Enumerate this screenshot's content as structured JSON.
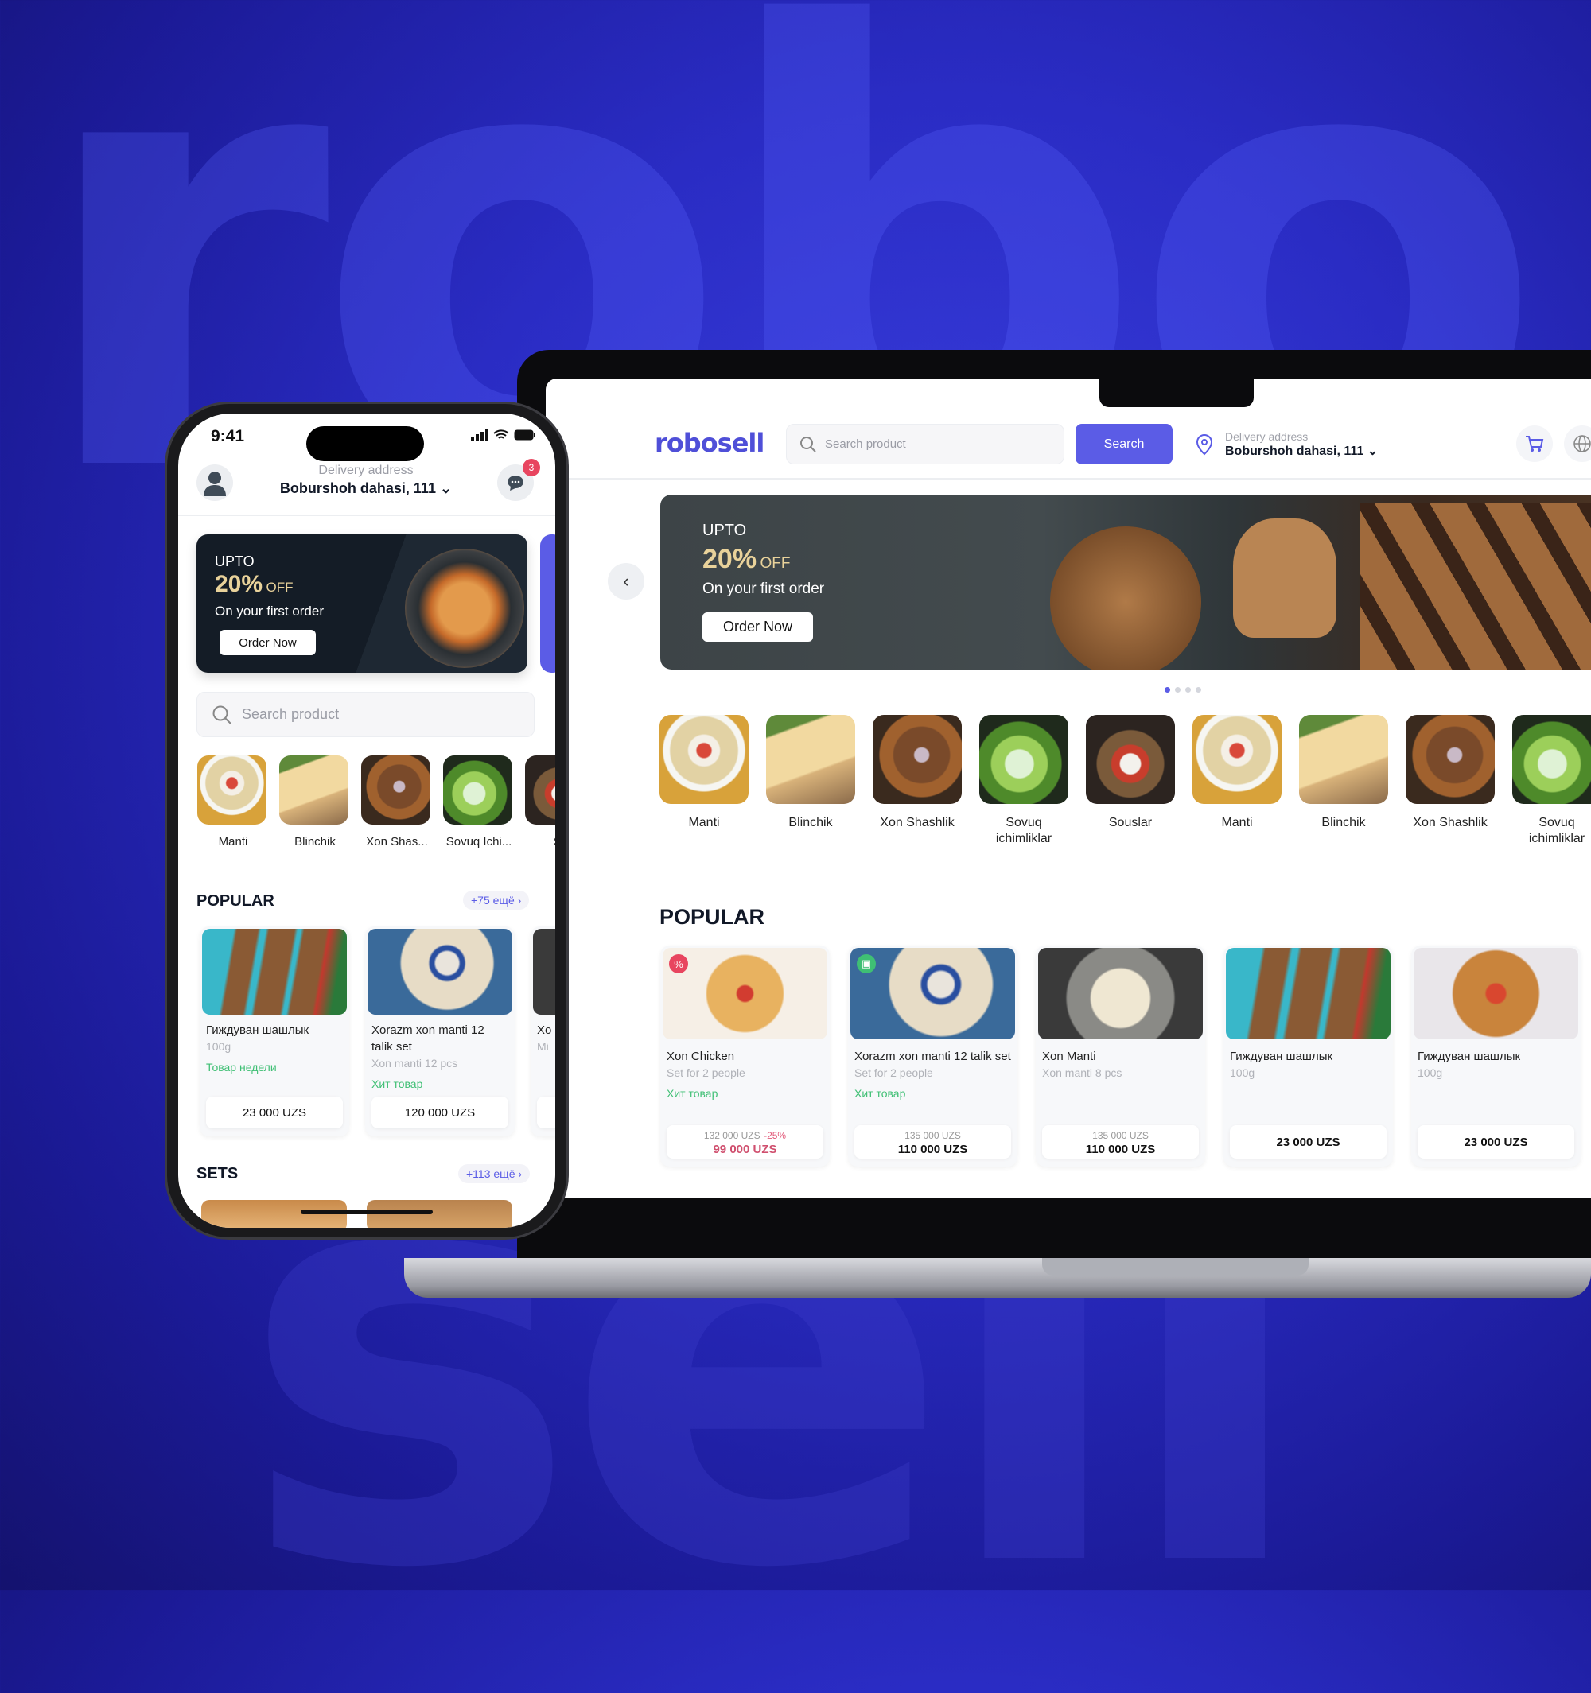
{
  "background": {
    "watermark_top": "robo",
    "watermark_bottom": "sell"
  },
  "colors": {
    "accent": "#5b5ce6",
    "promo_pct": "#e9d29a",
    "tag_green": "#3fbf74",
    "badge_red": "#e8455f",
    "discount_red": "#d0506f"
  },
  "laptop": {
    "logo": "robosell",
    "search": {
      "placeholder": "Search product",
      "button": "Search"
    },
    "delivery": {
      "label": "Delivery address",
      "address": "Boburshoh dahasi, 111"
    },
    "icons": [
      "cart-icon",
      "globe-icon",
      "location-pin-icon",
      "search-icon",
      "chevron-left-icon"
    ],
    "banner": {
      "upto": "UPTO",
      "pct": "20%",
      "off": "OFF",
      "subtitle": "On your first order",
      "button": "Order Now",
      "active_slide": 1,
      "slides": 4
    },
    "categories": [
      {
        "label": "Manti"
      },
      {
        "label": "Blinchik"
      },
      {
        "label": "Xon Shashlik"
      },
      {
        "label": "Sovuq ichimliklar"
      },
      {
        "label": "Souslar"
      },
      {
        "label": "Manti"
      },
      {
        "label": "Blinchik"
      },
      {
        "label": "Xon Shashlik"
      },
      {
        "label": "Sovuq ichimliklar"
      }
    ],
    "popular_title": "POPULAR",
    "popular": [
      {
        "title": "Xon Chicken",
        "sub": "Set for 2 people",
        "tag": "Хит товар",
        "old": "132 000 UZS",
        "discount": "-25%",
        "price": "99 000 UZS",
        "badge": "%"
      },
      {
        "title": "Xorazm xon manti 12 talik set",
        "sub": "Set for 2 people",
        "tag": "Хит товар",
        "old": "135 000 UZS",
        "price": "110 000 UZS",
        "badge": "gift"
      },
      {
        "title": "Xon Manti",
        "sub": "Xon manti 8 pcs",
        "old": "135 000 UZS",
        "price": "110 000 UZS"
      },
      {
        "title": "Гиждуван шашлык",
        "sub": "100g",
        "price": "23 000 UZS"
      },
      {
        "title": "Гиждуван шашлык",
        "sub": "100g",
        "price": "23 000 UZS"
      }
    ]
  },
  "phone": {
    "status": {
      "time": "9:41"
    },
    "delivery": {
      "label": "Delivery address",
      "address": "Boburshoh dahasi, 111"
    },
    "chat_badge": "3",
    "banner": {
      "upto": "UPTO",
      "pct": "20%",
      "off": "OFF",
      "subtitle": "On your first order",
      "button": "Order Now"
    },
    "search": {
      "placeholder": "Search product"
    },
    "categories": [
      {
        "label": "Manti"
      },
      {
        "label": "Blinchik"
      },
      {
        "label": "Xon Shas..."
      },
      {
        "label": "Sovuq Ichi..."
      },
      {
        "label": "So"
      }
    ],
    "popular": {
      "title": "POPULAR",
      "more": "+75 ещё ›",
      "items": [
        {
          "title": "Гиждуван шашлык",
          "sub": "100g",
          "tag": "Товар недели",
          "price": "23 000 UZS"
        },
        {
          "title": "Xorazm xon manti 12 talik set",
          "sub": "Xon manti 12 pcs",
          "tag": "Хит товар",
          "price": "120 000 UZS"
        },
        {
          "title": "Xo",
          "sub": "Mi",
          "price": ""
        }
      ]
    },
    "sets": {
      "title": "SETS",
      "more": "+113 ещё ›"
    }
  }
}
